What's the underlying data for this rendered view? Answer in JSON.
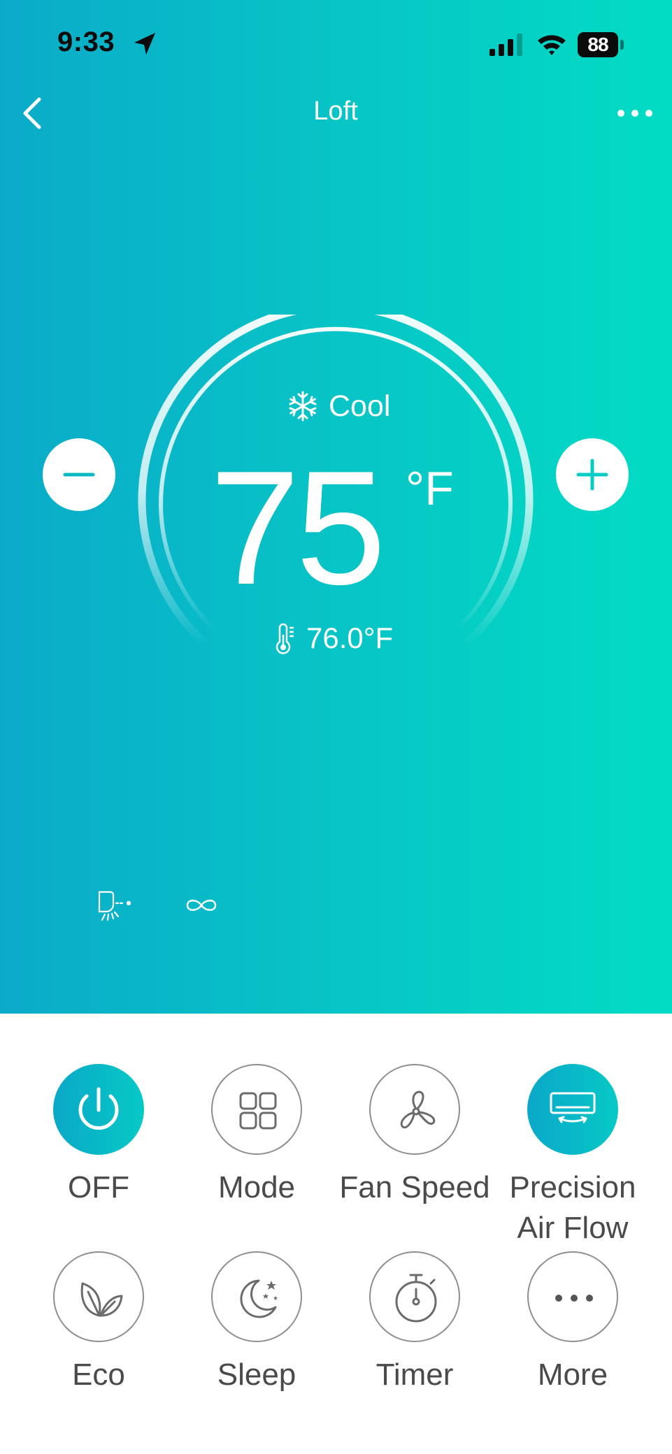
{
  "status_bar": {
    "time": "9:33",
    "battery": "88"
  },
  "header": {
    "title": "Loft"
  },
  "thermostat": {
    "mode": "Cool",
    "setpoint": "75",
    "unit": "°F",
    "current_temp": "76.0°F"
  },
  "colors": {
    "gradient_start": "#0aabc9",
    "gradient_end": "#02dcc4",
    "label_text": "#4a4a4a",
    "outline": "#8e8e8e"
  },
  "controls": {
    "power": {
      "label": "OFF",
      "icon": "power-icon",
      "active": true
    },
    "mode": {
      "label": "Mode",
      "icon": "grid-icon",
      "active": false
    },
    "fan_speed": {
      "label": "Fan Speed",
      "icon": "fan-icon",
      "active": false
    },
    "precision_air_flow": {
      "label": "Precision Air Flow",
      "icon": "air-conditioner-icon",
      "active": true
    },
    "eco": {
      "label": "Eco",
      "icon": "leaf-icon",
      "active": false
    },
    "sleep": {
      "label": "Sleep",
      "icon": "moon-icon",
      "active": false
    },
    "timer": {
      "label": "Timer",
      "icon": "stopwatch-icon",
      "active": false
    },
    "more": {
      "label": "More",
      "icon": "ellipsis-icon",
      "active": false
    }
  }
}
